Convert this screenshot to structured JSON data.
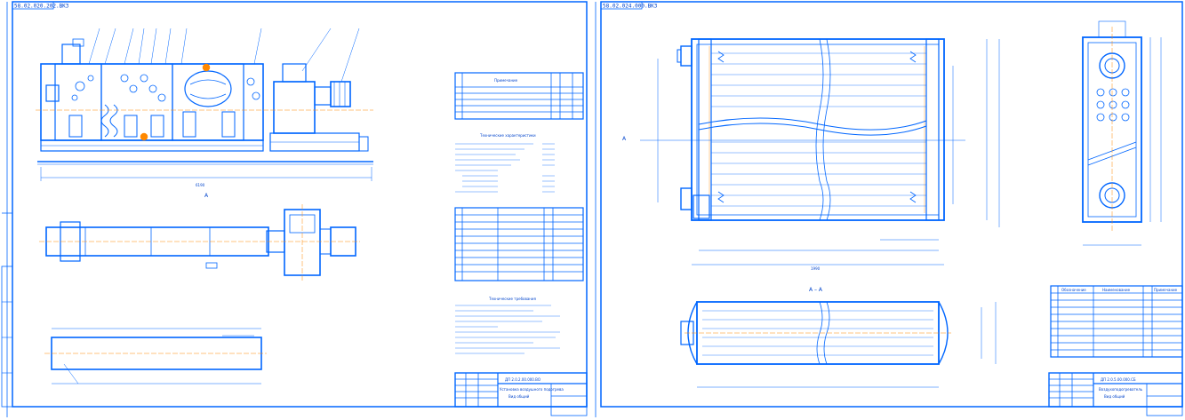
{
  "colors": {
    "line": "#0066ff",
    "thin": "#3377ff",
    "axis": "#ff8800",
    "dark": "#001a66",
    "paper": "#ffffff"
  },
  "sheet1": {
    "code_stamp": "58.02.020.202.ВКЗ",
    "section_mark": "А",
    "spec_header": "Примечание",
    "tech_header": "Технические характеристики",
    "notes_header": "Технические требования",
    "title_code": "ДП 2.0.2.00.000.ВО",
    "title_name": "Установка воздушного подогрева",
    "title_sub": "Вид общий"
  },
  "sheet2": {
    "code_stamp": "58.02.024.000.ВКЗ",
    "section_mark": "А",
    "section_title": "А – А",
    "spec_header_1": "Обозначение",
    "spec_header_2": "Наименование",
    "spec_header_3": "Примечание",
    "title_code": "ДП 2.0.5.00.000.СБ",
    "title_name": "Воздухоподогреватель",
    "title_sub": "Вид общий"
  },
  "dimensions": {
    "overall_1": "6190",
    "overall_2": "1990"
  }
}
